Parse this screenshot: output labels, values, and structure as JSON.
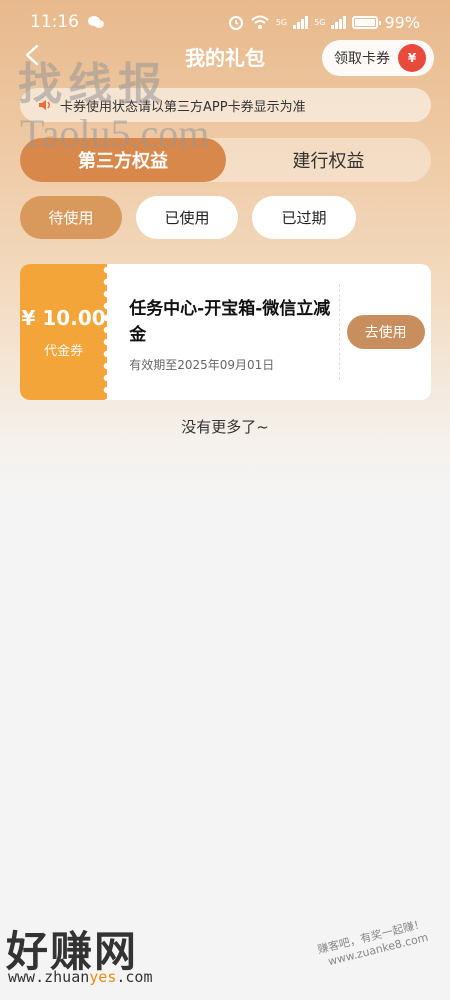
{
  "status_bar": {
    "time": "11:16",
    "battery": "99%",
    "network_1": "5G",
    "network_2": "5G"
  },
  "nav": {
    "title": "我的礼包",
    "claim_label": "领取卡券",
    "gift_symbol": "¥"
  },
  "notice": "卡券使用状态请以第三方APP卡券显示为准",
  "tabs": [
    {
      "label": "第三方权益",
      "active": true
    },
    {
      "label": "建行权益",
      "active": false
    }
  ],
  "filters": [
    {
      "label": "待使用",
      "active": true
    },
    {
      "label": "已使用",
      "active": false
    },
    {
      "label": "已过期",
      "active": false
    }
  ],
  "coupon": {
    "amount": "¥ 10.00",
    "type": "代金券",
    "name": "任务中心-开宝箱-微信立减金",
    "expiry": "有效期至2025年09月01日",
    "use_label": "去使用"
  },
  "end_text": "没有更多了~",
  "watermarks": {
    "top": "找线报",
    "url_top": "Taolu5.com",
    "bottom_brand": "好赚网",
    "bottom_url_pre": "www.zhuan",
    "bottom_url_hl": "yes",
    "bottom_url_post": ".com",
    "bottom_right_1": "赚客吧，有奖一起赚！",
    "bottom_right_2": "www.zuanke8.com"
  },
  "colors": {
    "accent": "#d9884b",
    "coupon_orange": "#f3a53a",
    "use_button": "#c98e5d"
  }
}
